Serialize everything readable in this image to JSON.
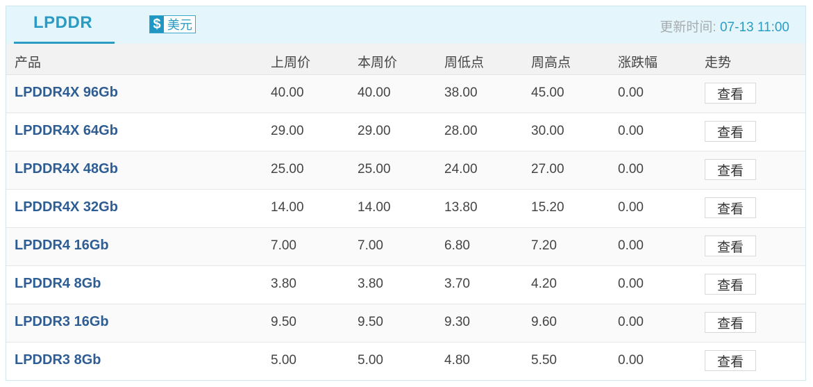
{
  "header": {
    "tab_label": "LPDDR",
    "currency_icon": "$",
    "currency_label": "美元",
    "update_label": "更新时间:",
    "update_time": "07-13 11:00"
  },
  "columns": [
    "产品",
    "上周价",
    "本周价",
    "周低点",
    "周高点",
    "涨跌幅",
    "走势"
  ],
  "rows": [
    {
      "name": "LPDDR4X 96Gb",
      "last_week": "40.00",
      "this_week": "40.00",
      "low": "38.00",
      "high": "45.00",
      "change": "0.00",
      "action": "查看"
    },
    {
      "name": "LPDDR4X 64Gb",
      "last_week": "29.00",
      "this_week": "29.00",
      "low": "28.00",
      "high": "30.00",
      "change": "0.00",
      "action": "查看"
    },
    {
      "name": "LPDDR4X 48Gb",
      "last_week": "25.00",
      "this_week": "25.00",
      "low": "24.00",
      "high": "27.00",
      "change": "0.00",
      "action": "查看"
    },
    {
      "name": "LPDDR4X 32Gb",
      "last_week": "14.00",
      "this_week": "14.00",
      "low": "13.80",
      "high": "15.20",
      "change": "0.00",
      "action": "查看"
    },
    {
      "name": "LPDDR4 16Gb",
      "last_week": "7.00",
      "this_week": "7.00",
      "low": "6.80",
      "high": "7.20",
      "change": "0.00",
      "action": "查看"
    },
    {
      "name": "LPDDR4 8Gb",
      "last_week": "3.80",
      "this_week": "3.80",
      "low": "3.70",
      "high": "4.20",
      "change": "0.00",
      "action": "查看"
    },
    {
      "name": "LPDDR3 16Gb",
      "last_week": "9.50",
      "this_week": "9.50",
      "low": "9.30",
      "high": "9.60",
      "change": "0.00",
      "action": "查看"
    },
    {
      "name": "LPDDR3 8Gb",
      "last_week": "5.00",
      "this_week": "5.00",
      "low": "4.80",
      "high": "5.50",
      "change": "0.00",
      "action": "查看"
    }
  ],
  "colors": {
    "accent": "#2a9cc3",
    "header_bg": "#e4f6fc",
    "product_link": "#2e5d94"
  }
}
